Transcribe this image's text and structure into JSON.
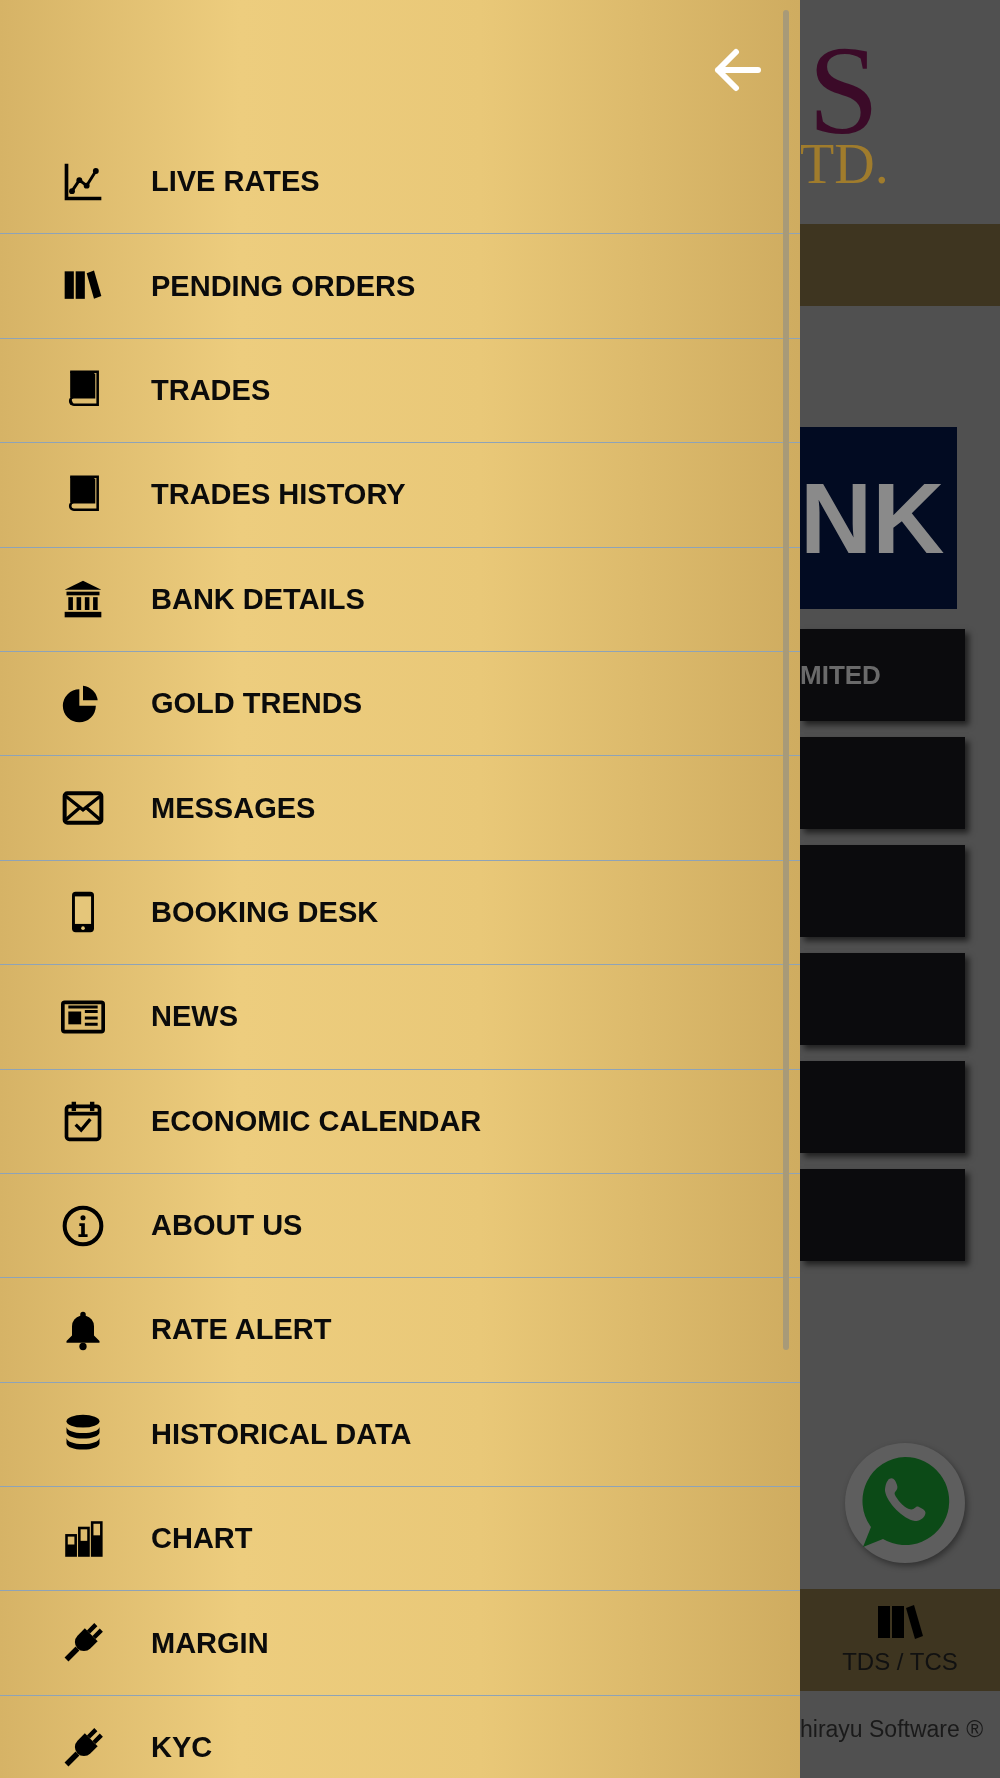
{
  "drawer": {
    "items": [
      {
        "label": "LIVE RATES"
      },
      {
        "label": "PENDING ORDERS"
      },
      {
        "label": "TRADES"
      },
      {
        "label": "TRADES HISTORY"
      },
      {
        "label": "BANK DETAILS"
      },
      {
        "label": "GOLD TRENDS"
      },
      {
        "label": "MESSAGES"
      },
      {
        "label": "BOOKING DESK"
      },
      {
        "label": "NEWS"
      },
      {
        "label": "ECONOMIC CALENDAR"
      },
      {
        "label": "ABOUT US"
      },
      {
        "label": "RATE ALERT"
      },
      {
        "label": "HISTORICAL DATA"
      },
      {
        "label": "CHART"
      },
      {
        "label": "MARGIN"
      },
      {
        "label": "KYC"
      }
    ]
  },
  "background": {
    "logo_letter": "S",
    "logo_suffix": "TD.",
    "banner_text": "NK",
    "first_button": "MITED",
    "bottom_tab": "TDS / TCS",
    "footer": "hirayu Software ®"
  }
}
